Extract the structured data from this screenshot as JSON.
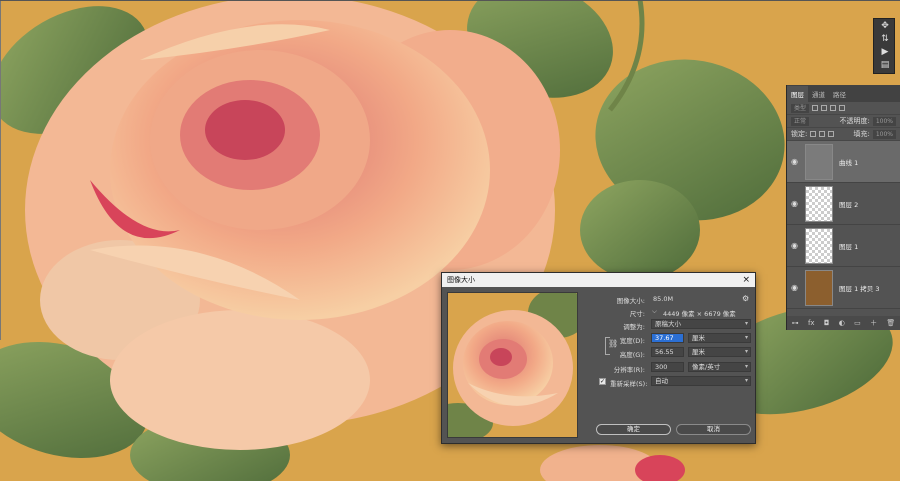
{
  "tool_strip": {
    "buttons": [
      "✥",
      "⇅",
      "▶",
      "▤"
    ]
  },
  "layers_panel": {
    "tabs": [
      "图层",
      "通道",
      "路径"
    ],
    "search_placeholder": "类型",
    "blend_mode": "正常",
    "opacity_label": "不透明度:",
    "opacity_value": "100%",
    "lock_label": "锁定:",
    "fill_label": "填充:",
    "fill_value": "100%",
    "layers": [
      {
        "name": "曲线 1",
        "type": "adjustment",
        "selected": true
      },
      {
        "name": "图层 2",
        "type": "pixel",
        "selected": false
      },
      {
        "name": "图层 1",
        "type": "pixel",
        "selected": false
      },
      {
        "name": "图层 1 拷贝 3",
        "type": "solid",
        "selected": false
      }
    ],
    "bottom_icons": [
      "⊶",
      "fx",
      "◘",
      "◐",
      "▭",
      "＋",
      "🗑"
    ]
  },
  "dialog": {
    "title": "图像大小",
    "close_glyph": "×",
    "image_size_label": "图像大小:",
    "image_size_value": "85.0M",
    "gear_glyph": "⚙",
    "dimensions_label": "尺寸:",
    "dimensions_value": "4449 像素 × 6679 像素",
    "fit_label": "调整为:",
    "fit_value": "原稿大小",
    "width_label": "宽度(D):",
    "width_value": "37.67",
    "width_unit": "厘米",
    "height_label": "高度(G):",
    "height_value": "56.55",
    "height_unit": "厘米",
    "resolution_label": "分辨率(R):",
    "resolution_value": "300",
    "resolution_unit": "像素/英寸",
    "resample_label": "重新采样(S):",
    "resample_checked": true,
    "resample_value": "自动",
    "ok_label": "确定",
    "cancel_label": "取消"
  },
  "colors": {
    "background": "#d9a44c",
    "panel": "#535353",
    "accent": "#2b6fd4"
  }
}
